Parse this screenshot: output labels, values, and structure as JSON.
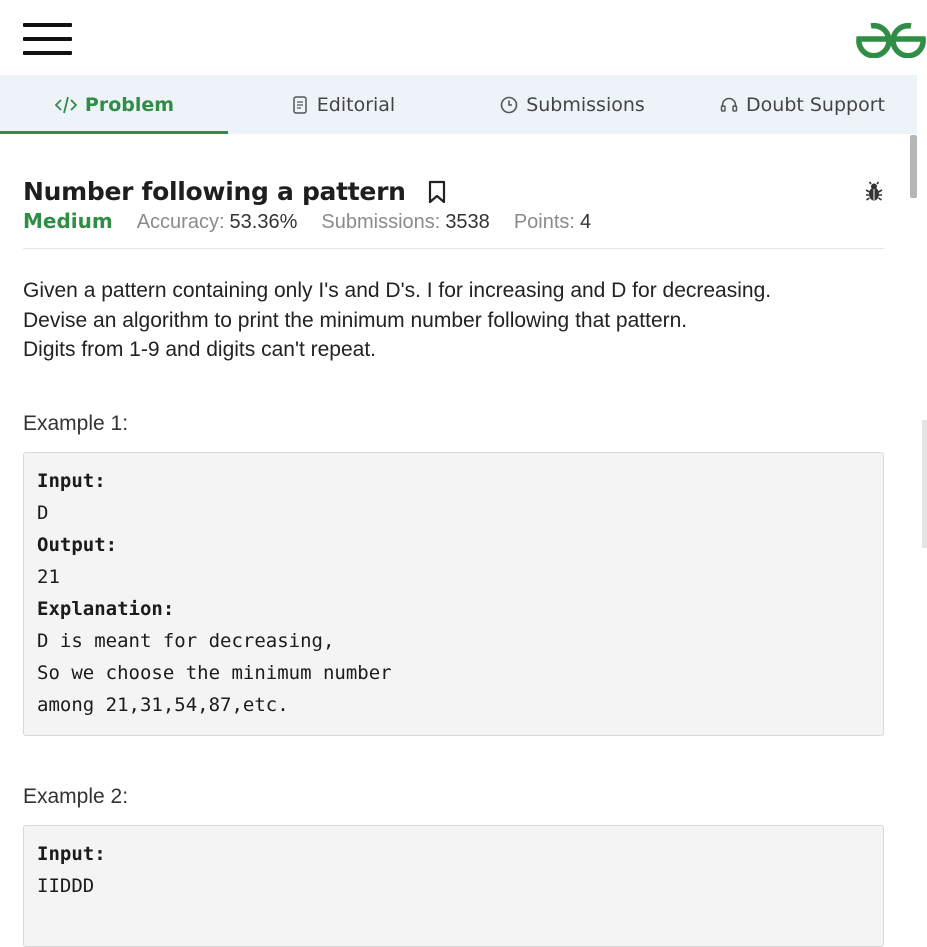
{
  "header": {
    "menu_icon": "hamburger-menu-icon",
    "logo_icon": "gfg-logo-icon",
    "logo_color": "#2f8d46"
  },
  "tabs": [
    {
      "label": "Problem",
      "icon": "code-icon",
      "active": true
    },
    {
      "label": "Editorial",
      "icon": "document-icon",
      "active": false
    },
    {
      "label": "Submissions",
      "icon": "clock-icon",
      "active": false
    },
    {
      "label": "Doubt Support",
      "icon": "headset-icon",
      "active": false
    }
  ],
  "problem": {
    "title": "Number following a pattern",
    "difficulty": "Medium",
    "accuracy_label": "Accuracy:",
    "accuracy_value": "53.36%",
    "submissions_label": "Submissions:",
    "submissions_value": "3538",
    "points_label": "Points:",
    "points_value": "4",
    "description": "Given a pattern containing only I's and D's. I for increasing and D for decreasing.\nDevise an algorithm to print the minimum number following that pattern.\nDigits from 1-9 and digits can't repeat."
  },
  "examples": [
    {
      "heading": "Example 1:",
      "input_label": "Input:",
      "input": "D",
      "output_label": "Output:",
      "output": "21",
      "explanation_label": "Explanation:",
      "explanation": "D is meant for decreasing,\nSo we choose the minimum number\namong 21,31,54,87,etc."
    },
    {
      "heading": "Example 2:",
      "input_label": "Input:",
      "input": "IIDDD"
    }
  ],
  "colors": {
    "accent": "#2f8d46",
    "tab_bar": "#eef3fa",
    "code_bg": "#f4f4f4"
  }
}
